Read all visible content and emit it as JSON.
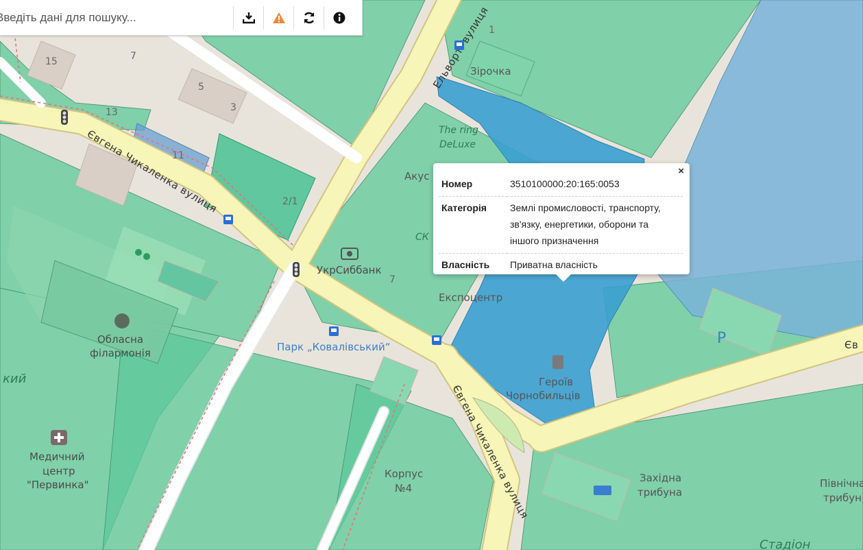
{
  "search": {
    "placeholder": "Введіть дані для пошуку..."
  },
  "toolbar": {
    "buttons": [
      {
        "icon": "download-icon"
      },
      {
        "icon": "warning-icon",
        "color": "#f0883e"
      },
      {
        "icon": "refresh-icon"
      },
      {
        "icon": "info-icon"
      }
    ]
  },
  "map": {
    "streets": {
      "chykalenka_left": "Євгена Чикаленка вулиця",
      "chykalenka_bottom": "Євгена Чикаленка вулиця",
      "elvorti": "Ельворті вулиця",
      "right_edge": "Єв"
    },
    "places": {
      "zirochka": "Зірочка",
      "the_ring": "The ring",
      "deluxe": "DeLuxe",
      "akus": "Акус",
      "ck": "СК",
      "ukrsibbank": "УкрСиббанк",
      "expocentr": "Експоцентр",
      "park": "Парк „Ковалівський“",
      "philharmonia_1": "Обласна",
      "philharmonia_2": "філармонія",
      "medical_1": "Медичний",
      "medical_2": "центр",
      "medical_3": "\"Первинка\"",
      "korpus_1": "Корпус",
      "korpus_2": "№4",
      "heroes_1": "Героїв",
      "heroes_2": "Чорнобильців",
      "west_1": "Західна",
      "west_2": "трибуна",
      "north_1": "Північна",
      "north_2": "трибун",
      "stadium": "Стадіон",
      "kyi_fragment": "кий"
    },
    "house_numbers": [
      "15",
      "7",
      "5",
      "3",
      "13",
      "11",
      "2/1",
      "1",
      "7"
    ],
    "colors": {
      "parcel_green": "#5cc99a",
      "parcel_selected": "#3a9fd0",
      "road_yellow": "#f7f5b7",
      "road_outline": "#d6c98c",
      "parkland": "#cdebb0"
    }
  },
  "popup": {
    "close": "×",
    "rows": [
      {
        "key": "Номер",
        "value": "3510100000:20:165:0053"
      },
      {
        "key": "Категорія",
        "value": "Землі промисловості, транспорту, зв'язку, енергетики, оборони та іншого призначення"
      },
      {
        "key": "Власність",
        "value": "Приватна власність"
      }
    ]
  }
}
